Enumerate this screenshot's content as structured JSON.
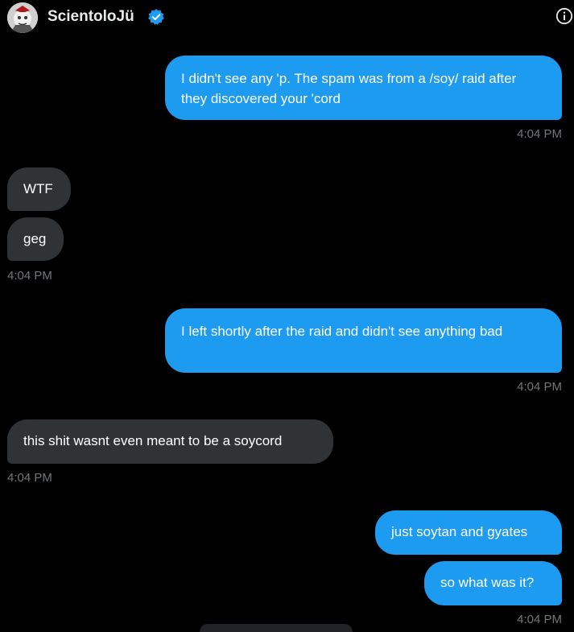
{
  "header": {
    "name": "ScientoloJü",
    "avatar_icon": "avatar-image",
    "verified_icon": "verified-badge-icon",
    "info_icon": "info-icon"
  },
  "colors": {
    "background": "#000000",
    "sent_bubble": "#1d9bf0",
    "received_bubble": "#2f3336",
    "timestamp": "#71767b"
  },
  "messages": [
    {
      "direction": "sent",
      "text": "I didn't see any 'p. The spam was from a /soy/ raid after they discovered your 'cord"
    },
    {
      "timestamp": "4:04 PM"
    },
    {
      "direction": "received",
      "text": "WTF"
    },
    {
      "direction": "received",
      "text": "geg"
    },
    {
      "timestamp": "4:04 PM"
    },
    {
      "direction": "sent",
      "text": "I left shortly after the raid and didn't see anything bad"
    },
    {
      "timestamp": "4:04 PM"
    },
    {
      "direction": "received",
      "text": "this shit wasnt even meant to be a soycord"
    },
    {
      "timestamp": "4:04 PM"
    },
    {
      "direction": "sent",
      "text": "just soytan and gyates"
    },
    {
      "direction": "sent",
      "text": "so what was it?"
    },
    {
      "timestamp": "4:04 PM"
    }
  ]
}
